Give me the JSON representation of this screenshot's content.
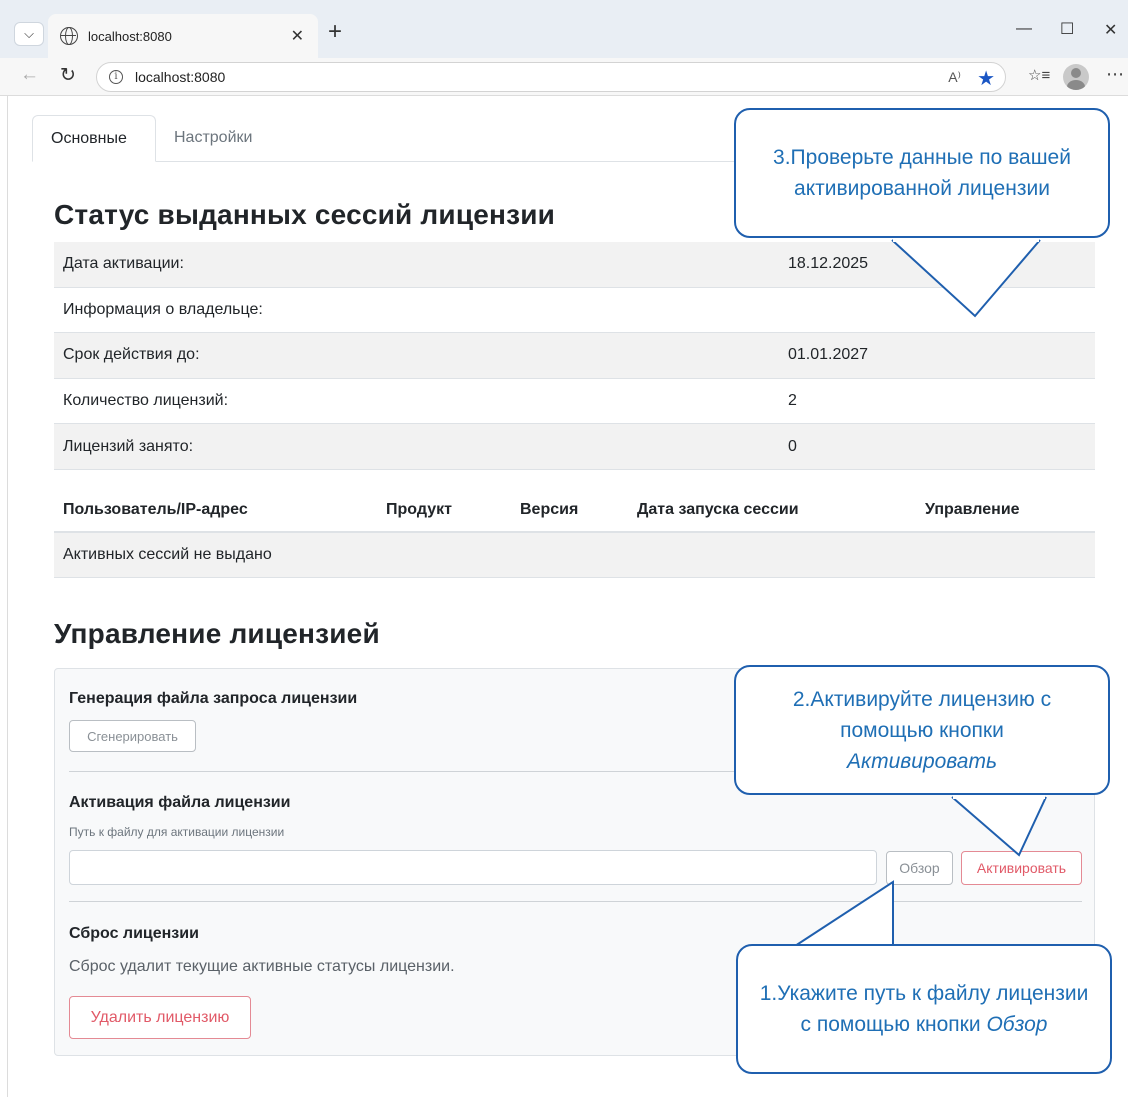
{
  "browser": {
    "tab_title": "localhost:8080",
    "url": "localhost:8080",
    "new_tab_label": "+",
    "read_aloud_label": "A⁾"
  },
  "tabs": [
    {
      "label": "Основные",
      "active": true
    },
    {
      "label": "Настройки",
      "active": false
    }
  ],
  "status": {
    "title": "Статус выданных сессий лицензии",
    "rows": [
      {
        "label": "Дата активации:",
        "value": "18.12.2025"
      },
      {
        "label": "Информация о владельце:",
        "value": ""
      },
      {
        "label": "Срок действия до:",
        "value": "01.01.2027"
      },
      {
        "label": "Количество лицензий:",
        "value": "2"
      },
      {
        "label": "Лицензий занято:",
        "value": "0"
      }
    ]
  },
  "sessions": {
    "headers": {
      "user": "Пользователь/IP-адрес",
      "product": "Продукт",
      "version": "Версия",
      "started": "Дата запуска сессии",
      "manage": "Управление"
    },
    "empty_text": "Активных сессий не выдано"
  },
  "management": {
    "title": "Управление лицензией",
    "generate": {
      "heading": "Генерация файла запроса лицензии",
      "button": "Сгенерировать"
    },
    "activate": {
      "heading": "Активация файла лицензии",
      "path_label": "Путь к файлу для активации лицензии",
      "path_value": "",
      "path_placeholder": "",
      "browse_button": "Обзор",
      "activate_button": "Активировать"
    },
    "reset": {
      "heading": "Сброс лицензии",
      "description": "Сброс удалит текущие активные статусы лицензии.",
      "button": "Удалить лицензию"
    }
  },
  "callouts": {
    "c3_text": "3.Проверьте данные по вашей активированной лицензии",
    "c2_text": "2.Активируйте лицензию с помощью кнопки",
    "c2_emph": "Активировать",
    "c1_text": "1.Укажите путь к файлу лицензии с помощью кнопки",
    "c1_emph": "Обзор",
    "border_color": "#1f5fae",
    "text_color": "#1f6fb5"
  }
}
